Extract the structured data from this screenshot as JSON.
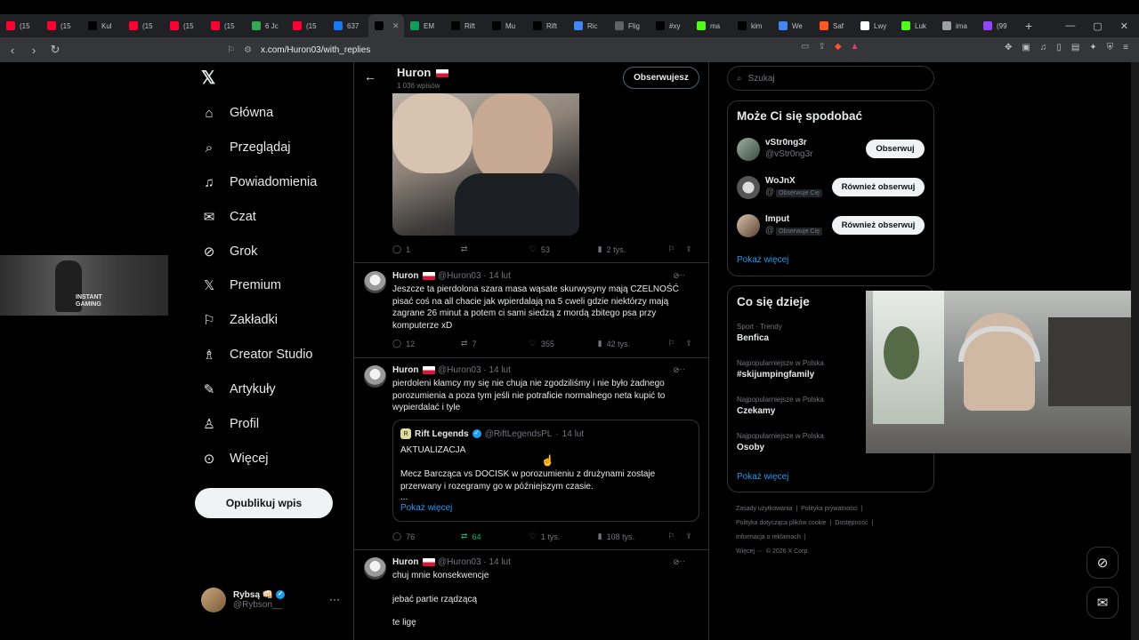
{
  "browser": {
    "tabs": [
      {
        "label": "(15",
        "fav": "youtube-icon",
        "color": "#ff0033"
      },
      {
        "label": "(15",
        "fav": "youtube-icon",
        "color": "#ff0033"
      },
      {
        "label": "Kul",
        "fav": "x-icon",
        "color": "#000000"
      },
      {
        "label": "(15",
        "fav": "youtube-icon",
        "color": "#ff0033"
      },
      {
        "label": "(15",
        "fav": "youtube-icon",
        "color": "#ff0033"
      },
      {
        "label": "(15",
        "fav": "youtube-icon",
        "color": "#ff0033"
      },
      {
        "label": "6 Jc",
        "fav": "maps-icon",
        "color": "#34a853"
      },
      {
        "label": "(15",
        "fav": "youtube-icon",
        "color": "#ff0033"
      },
      {
        "label": "637",
        "fav": "facebook-icon",
        "color": "#1877f2"
      },
      {
        "label": "",
        "fav": "x-icon",
        "color": "#000000"
      },
      {
        "label": "EM",
        "fav": "sheets-icon",
        "color": "#0f9d58"
      },
      {
        "label": "Rift",
        "fav": "x-icon",
        "color": "#000000"
      },
      {
        "label": "Mu",
        "fav": "x-icon",
        "color": "#000000"
      },
      {
        "label": "Rift",
        "fav": "x-icon",
        "color": "#000000"
      },
      {
        "label": "Ric",
        "fav": "google-icon",
        "color": "#4285f4"
      },
      {
        "label": "Flig",
        "fav": "flight-icon",
        "color": "#5f6368"
      },
      {
        "label": "#xy",
        "fav": "tiktok-icon",
        "color": "#000000"
      },
      {
        "label": "ma",
        "fav": "kick-icon",
        "color": "#53fc18"
      },
      {
        "label": "kim",
        "fav": "tiktok-icon",
        "color": "#000000"
      },
      {
        "label": "We",
        "fav": "docs-icon",
        "color": "#4285f4"
      },
      {
        "label": "Saf",
        "fav": "saf-icon",
        "color": "#ff5722"
      },
      {
        "label": "Lwy",
        "fav": "lwy-icon",
        "color": "#ffffff"
      },
      {
        "label": "Luk",
        "fav": "kick-icon",
        "color": "#53fc18"
      },
      {
        "label": "ima",
        "fav": "globe-icon",
        "color": "#9aa0a6"
      },
      {
        "label": "(99",
        "fav": "twitch-icon",
        "color": "#9146ff"
      }
    ],
    "url": "x.com/Huron03/with_replies"
  },
  "nav": {
    "items": [
      "Główna",
      "Przeglądaj",
      "Powiadomienia",
      "Czat",
      "Grok",
      "Premium",
      "Zakładki",
      "Creator Studio",
      "Artykuły",
      "Profil",
      "Więcej"
    ],
    "publish": "Opublikuj wpis",
    "account_name": "Rybsą 👊🏻",
    "account_handle": "@Rybson__"
  },
  "header": {
    "name": "Huron",
    "posts": "1 036 wpisów",
    "follow_state": "Obserwujesz"
  },
  "tweets": [
    {
      "name": "Huron",
      "handle": "@Huron03",
      "date": "14 lut",
      "text": "Jeszcze ta pierdolona szara masa wąsate skurwysyny mają CZELNOŚĆ pisać coś na all chacie jak wpierdalają na 5 cweli gdzie niektórzy mają zagrane 26 minut a potem ci sami siedzą z mordą zbitego psa przy komputerze xD",
      "replies": "12",
      "reposts": "7",
      "likes": "355",
      "views": "42 tys."
    },
    {
      "name": "Huron",
      "handle": "@Huron03",
      "date": "14 lut",
      "text": "pierdoleni kłamcy my się nie chuja nie zgodziliśmy i nie było żadnego porozumienia a poza tym jeśli nie potraficie normalnego neta kupić to wypierdalać i tyle",
      "replies": "76",
      "reposts": "64",
      "likes": "1 tys.",
      "views": "108 tys."
    },
    {
      "name": "Huron",
      "handle": "@Huron03",
      "date": "14 lut",
      "line1": "chuj mnie konsekwencje",
      "line2": "jebać partie rządzącą",
      "line3": "te ligę"
    }
  ],
  "first_post_stats": {
    "replies": "1",
    "reposts": "",
    "likes": "53",
    "views": "2 tys."
  },
  "quote": {
    "name": "Rift Legends",
    "handle": "@RiftLegendsPL",
    "date": "14 lut",
    "title": "AKTUALIZACJA",
    "body": "Mecz Barcząca vs DOCISK w porozumieniu z drużynami zostaje przerwany i rozegramy go w późniejszym czasie.",
    "ellipsis": "...",
    "show_more": "Pokaż więcej"
  },
  "search": {
    "placeholder": "Szukaj"
  },
  "who_to_follow": {
    "title": "Może Ci się spodobać",
    "users": [
      {
        "name": "vStr0ng3r",
        "handle": "@vStr0ng3r",
        "badge": "",
        "button": "Obserwuj"
      },
      {
        "name": "WoJnX",
        "handle": "@",
        "badge": "Obserwuje Cię",
        "button": "Również obserwuj"
      },
      {
        "name": "Imput",
        "handle": "@",
        "badge": "Obserwuje Cię",
        "button": "Również obserwuj"
      }
    ],
    "show_more": "Pokaż więcej"
  },
  "trends": {
    "title": "Co się dzieje",
    "items": [
      {
        "category": "Sport · Trendy",
        "name": "Benfica"
      },
      {
        "category": "Najpopularniejsze w Polska",
        "name": "#skijumpingfamily"
      },
      {
        "category": "Najpopularniejsze w Polska",
        "name": "Czekamy"
      },
      {
        "category": "Najpopularniejsze w Polska",
        "name": "Osoby"
      }
    ],
    "show_more": "Pokaż więcej"
  },
  "footer": {
    "links": [
      "Zasady użytkowania",
      "|",
      "Polityka prywatności",
      "|",
      "Polityka dotycząca plików cookie",
      "|",
      "Dostępność",
      "|",
      "Informacja o reklamach",
      "|",
      "Więcej ···",
      "© 2026 X Corp."
    ]
  },
  "overlay": {
    "game_logo": "INSTANT GAMING"
  }
}
